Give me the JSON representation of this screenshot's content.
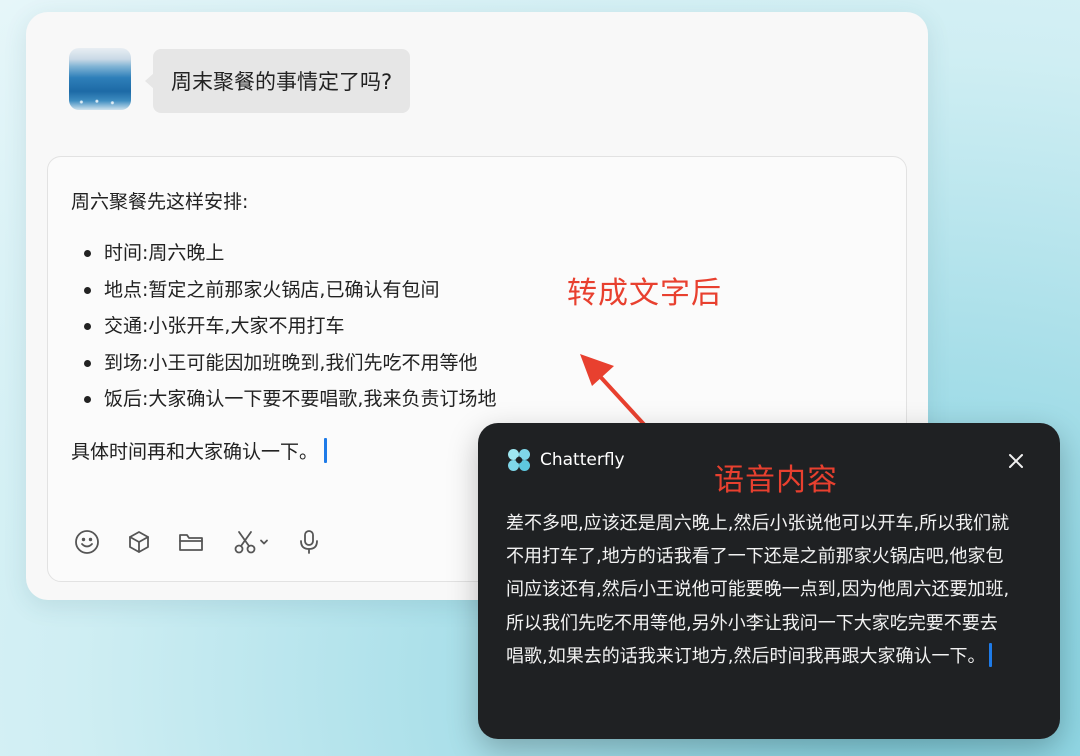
{
  "chat": {
    "question": "周末聚餐的事情定了吗?",
    "draft": {
      "intro": "周六聚餐先这样安排:",
      "items": [
        "时间:周六晚上",
        "地点:暂定之前那家火锅店,已确认有包间",
        "交通:小张开车,大家不用打车",
        "到场:小王可能因加班晚到,我们先吃不用等他",
        "饭后:大家确认一下要不要唱歌,我来负责订场地"
      ],
      "closing": "具体时间再和大家确认一下。"
    },
    "toolbar_icons": [
      "emoji-icon",
      "cube-icon",
      "folder-icon",
      "scissors-icon",
      "chevron-down-icon",
      "microphone-icon"
    ]
  },
  "annotations": {
    "converted": "转成文字后",
    "voice": "语音内容",
    "color": "#e8402f"
  },
  "popup": {
    "brand": "Chatterfly",
    "transcript": "差不多吧,应该还是周六晚上,然后小张说他可以开车,所以我们就不用打车了,地方的话我看了一下还是之前那家火锅店吧,他家包间应该还有,然后小王说他可能要晚一点到,因为他周六还要加班,所以我们先吃不用等他,另外小李让我问一下大家吃完要不要去唱歌,如果去的话我来订地方,然后时间我再跟大家确认一下。"
  },
  "colors": {
    "accent_cursor": "#1e7be8",
    "popup_bg": "#1f2123",
    "bubble_bg": "#e6e6e6"
  }
}
